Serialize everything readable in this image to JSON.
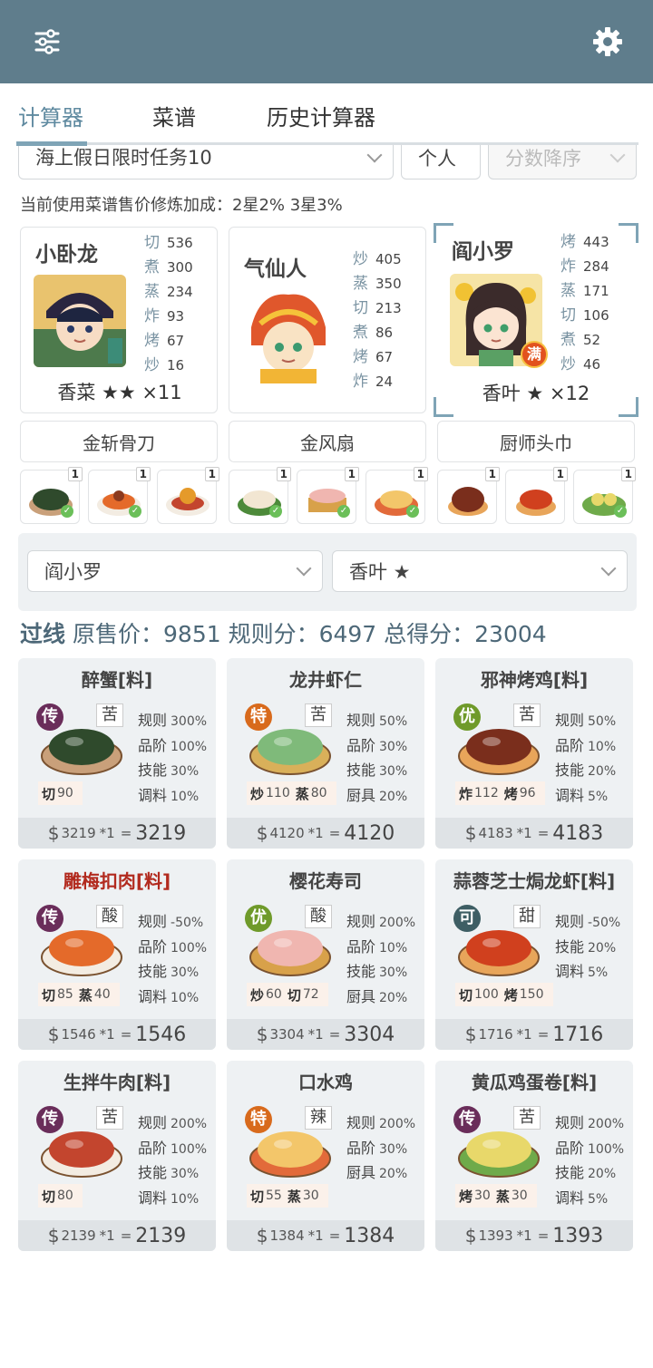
{
  "topbar": {
    "filter_icon": "sliders-icon",
    "settings_icon": "gear-icon"
  },
  "tabs": [
    {
      "label": "计算器",
      "active": true
    },
    {
      "label": "菜谱",
      "active": false
    },
    {
      "label": "历史计算器",
      "active": false
    }
  ],
  "filters": {
    "task": "海上假日限时任务10",
    "mode": "个人",
    "sort": "分数降序"
  },
  "note": "当前使用菜谱售价修炼加成：2星2% 3星3%",
  "chefs": [
    {
      "name": "小卧龙",
      "skills": [
        {
          "k": "切",
          "v": "536"
        },
        {
          "k": "煮",
          "v": "300"
        },
        {
          "k": "蒸",
          "v": "234"
        },
        {
          "k": "炸",
          "v": "93"
        },
        {
          "k": "烤",
          "v": "67"
        },
        {
          "k": "炒",
          "v": "16"
        }
      ],
      "footer": "香菜 ★★ ×11",
      "badge": ""
    },
    {
      "name": "气仙人",
      "skills": [
        {
          "k": "炒",
          "v": "405"
        },
        {
          "k": "蒸",
          "v": "350"
        },
        {
          "k": "切",
          "v": "213"
        },
        {
          "k": "煮",
          "v": "86"
        },
        {
          "k": "烤",
          "v": "67"
        },
        {
          "k": "炸",
          "v": "24"
        }
      ],
      "footer": "",
      "badge": ""
    },
    {
      "name": "阎小罗",
      "skills": [
        {
          "k": "烤",
          "v": "443"
        },
        {
          "k": "炸",
          "v": "284"
        },
        {
          "k": "蒸",
          "v": "171"
        },
        {
          "k": "切",
          "v": "106"
        },
        {
          "k": "煮",
          "v": "52"
        },
        {
          "k": "炒",
          "v": "46"
        }
      ],
      "footer": "香叶 ★ ×12",
      "badge": "满"
    }
  ],
  "equipment": [
    "金斩骨刀",
    "金风扇",
    "厨师头巾"
  ],
  "dish_counts": [
    "1",
    "1",
    "1",
    "1",
    "1",
    "1",
    "1",
    "1",
    "1"
  ],
  "selectors": {
    "chef": "阎小罗",
    "seasoning": "香叶 ★"
  },
  "summary": {
    "pass": "过线",
    "text": "原售价：9851 规则分：6497 总得分：23004"
  },
  "recipes": [
    {
      "title": "醉蟹[料]",
      "red": false,
      "grade": "传",
      "taste": "苦",
      "mods": [
        [
          "规则",
          "300%"
        ],
        [
          "品阶",
          "100%"
        ],
        [
          "技能",
          "30%"
        ],
        [
          "调料",
          "10%"
        ]
      ],
      "req": [
        [
          "切",
          "90"
        ]
      ],
      "price": "3219",
      "mult": "*1",
      "total": "3219"
    },
    {
      "title": "龙井虾仁",
      "red": false,
      "grade": "特",
      "taste": "苦",
      "mods": [
        [
          "规则",
          "50%"
        ],
        [
          "品阶",
          "30%"
        ],
        [
          "技能",
          "30%"
        ],
        [
          "厨具",
          "20%"
        ]
      ],
      "req": [
        [
          "炒",
          "110"
        ],
        [
          "蒸",
          "80"
        ]
      ],
      "price": "4120",
      "mult": "*1",
      "total": "4120"
    },
    {
      "title": "邪神烤鸡[料]",
      "red": false,
      "grade": "优",
      "taste": "苦",
      "mods": [
        [
          "规则",
          "50%"
        ],
        [
          "品阶",
          "10%"
        ],
        [
          "技能",
          "20%"
        ],
        [
          "调料",
          "5%"
        ]
      ],
      "req": [
        [
          "炸",
          "112"
        ],
        [
          "烤",
          "96"
        ]
      ],
      "price": "4183",
      "mult": "*1",
      "total": "4183"
    },
    {
      "title": "雕梅扣肉[料]",
      "red": true,
      "grade": "传",
      "taste": "酸",
      "mods": [
        [
          "规则",
          "-50%"
        ],
        [
          "品阶",
          "100%"
        ],
        [
          "技能",
          "30%"
        ],
        [
          "调料",
          "10%"
        ]
      ],
      "req": [
        [
          "切",
          "85"
        ],
        [
          "蒸",
          "40"
        ]
      ],
      "price": "1546",
      "mult": "*1",
      "total": "1546"
    },
    {
      "title": "樱花寿司",
      "red": false,
      "grade": "优",
      "taste": "酸",
      "mods": [
        [
          "规则",
          "200%"
        ],
        [
          "品阶",
          "10%"
        ],
        [
          "技能",
          "30%"
        ],
        [
          "厨具",
          "20%"
        ]
      ],
      "req": [
        [
          "炒",
          "60"
        ],
        [
          "切",
          "72"
        ]
      ],
      "price": "3304",
      "mult": "*1",
      "total": "3304"
    },
    {
      "title": "蒜蓉芝士焗龙虾[料]",
      "red": false,
      "grade": "可",
      "taste": "甜",
      "mods": [
        [
          "规则",
          "-50%"
        ],
        [
          "技能",
          "20%"
        ],
        [
          "调料",
          "5%"
        ]
      ],
      "req": [
        [
          "切",
          "100"
        ],
        [
          "烤",
          "150"
        ]
      ],
      "price": "1716",
      "mult": "*1",
      "total": "1716"
    },
    {
      "title": "生拌牛肉[料]",
      "red": false,
      "grade": "传",
      "taste": "苦",
      "mods": [
        [
          "规则",
          "200%"
        ],
        [
          "品阶",
          "100%"
        ],
        [
          "技能",
          "30%"
        ],
        [
          "调料",
          "10%"
        ]
      ],
      "req": [
        [
          "切",
          "80"
        ]
      ],
      "price": "2139",
      "mult": "*1",
      "total": "2139"
    },
    {
      "title": "口水鸡",
      "red": false,
      "grade": "特",
      "taste": "辣",
      "mods": [
        [
          "规则",
          "200%"
        ],
        [
          "品阶",
          "30%"
        ],
        [
          "厨具",
          "20%"
        ]
      ],
      "req": [
        [
          "切",
          "55"
        ],
        [
          "蒸",
          "30"
        ]
      ],
      "price": "1384",
      "mult": "*1",
      "total": "1384"
    },
    {
      "title": "黄瓜鸡蛋卷[料]",
      "red": false,
      "grade": "传",
      "taste": "苦",
      "mods": [
        [
          "规则",
          "200%"
        ],
        [
          "品阶",
          "100%"
        ],
        [
          "技能",
          "20%"
        ],
        [
          "调料",
          "5%"
        ]
      ],
      "req": [
        [
          "烤",
          "30"
        ],
        [
          "蒸",
          "30"
        ]
      ],
      "price": "1393",
      "mult": "*1",
      "total": "1393"
    }
  ],
  "colors": {
    "header": "#5f7d8c",
    "accent": "#7fa4b6",
    "grade_chuan": "#6a2d5a",
    "grade_te": "#d86a1c",
    "grade_you": "#6f9a2a",
    "grade_ke": "#3e5e64",
    "title_red": "#b22a1e"
  }
}
